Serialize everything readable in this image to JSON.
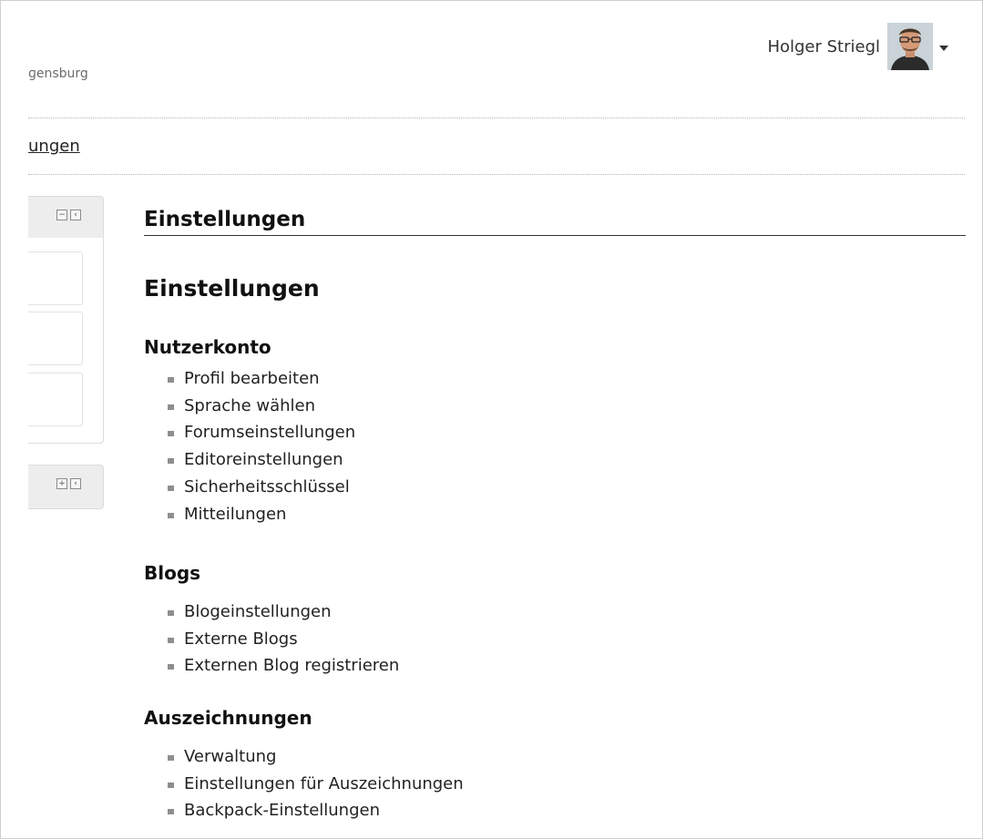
{
  "header": {
    "site_name": "ɡensburg",
    "user_name": "Holger Striegl",
    "avatar_icon": "user-avatar-photo",
    "menu_icon": "caret-down-icon"
  },
  "breadcrumb": {
    "current": "ungen"
  },
  "sidebar": {
    "collapse_icon": "minus-icon",
    "dock_icon": "dock-left-icon",
    "expand_icon": "plus-icon"
  },
  "main": {
    "heading": "Einstellungen",
    "title": "Einstellungen",
    "sections": [
      {
        "title": "Nutzerkonto",
        "links": [
          "Profil bearbeiten",
          "Sprache wählen",
          "Forumseinstellungen",
          "Editoreinstellungen",
          "Sicherheitsschlüssel",
          "Mitteilungen"
        ]
      },
      {
        "title": "Blogs",
        "links": [
          "Blogeinstellungen",
          "Externe Blogs",
          "Externen Blog registrieren"
        ]
      },
      {
        "title": "Auszeichnungen",
        "links": [
          "Verwaltung",
          "Einstellungen für Auszeichnungen",
          "Backpack-Einstellungen"
        ]
      }
    ]
  }
}
